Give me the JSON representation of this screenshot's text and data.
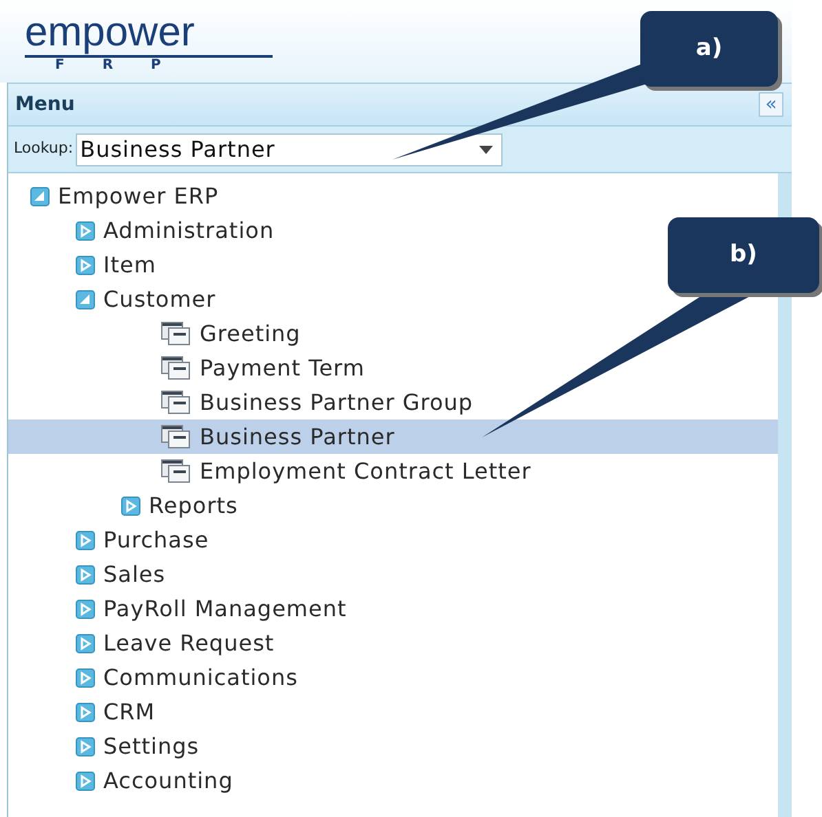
{
  "logo": {
    "name": "empower",
    "sub": "F R P"
  },
  "menu": {
    "title": "Menu",
    "collapse": "«"
  },
  "lookup": {
    "label": "Lookup:",
    "value": "Business Partner"
  },
  "tree": [
    {
      "label": "Empower ERP",
      "kind": "folder",
      "expanded": true,
      "selected": false,
      "children": [
        {
          "label": "Administration",
          "kind": "folder",
          "expanded": false,
          "selected": false
        },
        {
          "label": "Item",
          "kind": "folder",
          "expanded": false,
          "selected": false
        },
        {
          "label": "Customer",
          "kind": "folder",
          "expanded": true,
          "selected": false,
          "children": [
            {
              "label": "Greeting",
              "kind": "leaf",
              "selected": false
            },
            {
              "label": "Payment Term",
              "kind": "leaf",
              "selected": false
            },
            {
              "label": "Business Partner Group",
              "kind": "leaf",
              "selected": false
            },
            {
              "label": "Business Partner",
              "kind": "leaf",
              "selected": true
            },
            {
              "label": "Employment Contract Letter",
              "kind": "leaf",
              "selected": false
            },
            {
              "label": "Reports",
              "kind": "folder",
              "expanded": false,
              "selected": false
            }
          ]
        },
        {
          "label": "Purchase",
          "kind": "folder",
          "expanded": false,
          "selected": false
        },
        {
          "label": "Sales",
          "kind": "folder",
          "expanded": false,
          "selected": false
        },
        {
          "label": "PayRoll Management",
          "kind": "folder",
          "expanded": false,
          "selected": false
        },
        {
          "label": "Leave Request",
          "kind": "folder",
          "expanded": false,
          "selected": false
        },
        {
          "label": "Communications",
          "kind": "folder",
          "expanded": false,
          "selected": false
        },
        {
          "label": "CRM",
          "kind": "folder",
          "expanded": false,
          "selected": false
        },
        {
          "label": "Settings",
          "kind": "folder",
          "expanded": false,
          "selected": false
        },
        {
          "label": "Accounting",
          "kind": "folder",
          "expanded": false,
          "selected": false
        }
      ]
    }
  ],
  "callouts": [
    {
      "label": "a)"
    },
    {
      "label": "b)"
    }
  ]
}
